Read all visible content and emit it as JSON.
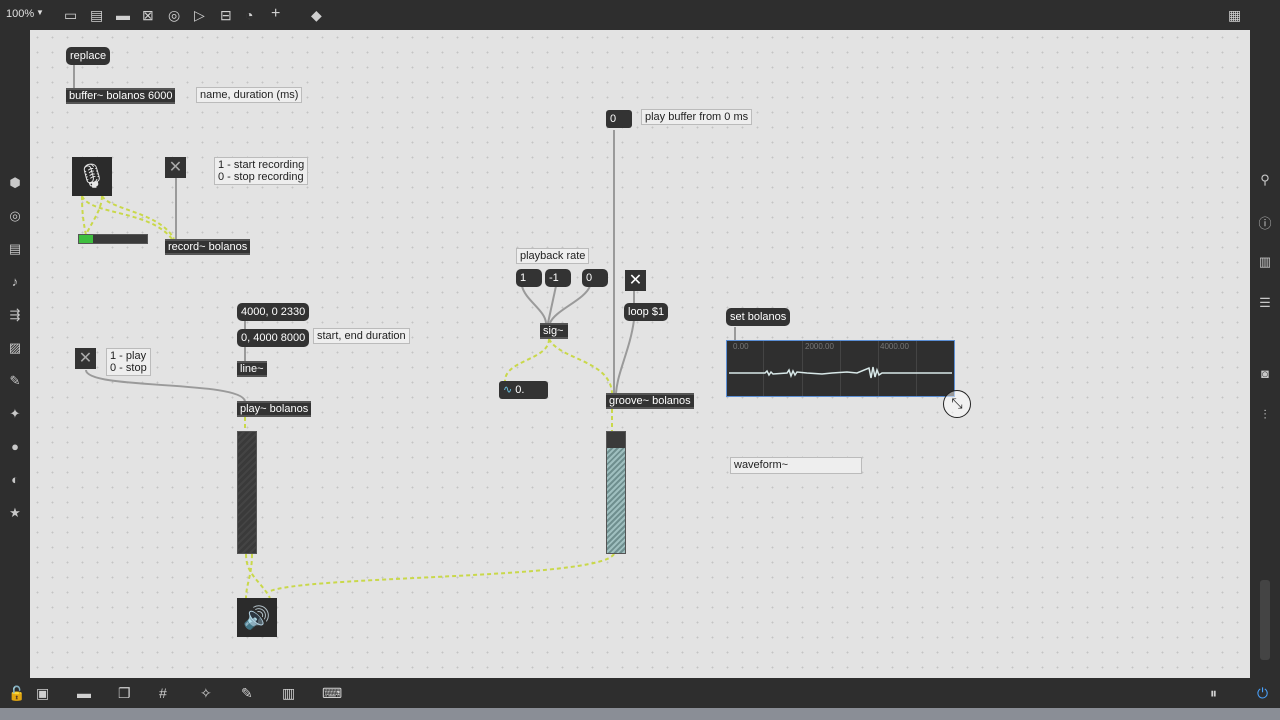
{
  "toolbar": {
    "zoom": "100%",
    "icons": [
      "new-object-icon",
      "message-icon",
      "comment-icon",
      "toggle-icon",
      "button-icon",
      "number-icon",
      "slider-icon",
      "dial-icon",
      "add-icon",
      "paint-icon",
      "grid-view-icon"
    ]
  },
  "left_sidebar": [
    "packages-icon",
    "target-icon",
    "browser-icon",
    "music-icon",
    "patcher-icon",
    "image-icon",
    "attachment-icon",
    "puzzle-icon",
    "vimeo-icon",
    "mask-icon",
    "star-icon"
  ],
  "right_sidebar": [
    "search-icon",
    "info-icon",
    "book-icon",
    "list-icon",
    "camera-icon",
    "sliders-icon"
  ],
  "bottom_toolbar": [
    "lock-icon",
    "presentation-icon",
    "comment-icon",
    "group-icon",
    "grid-icon",
    "snap-icon",
    "wrench-icon",
    "piano-icon",
    "keyboard-icon"
  ],
  "patch": {
    "replace_msg": "replace",
    "buffer_obj": "buffer~ bolanos 6000",
    "buffer_comment": "name, duration (ms)",
    "record_comment": "1 - start recording\n0 - stop recording",
    "record_obj": "record~ bolanos",
    "msg_4000_2330": "4000, 0 2330",
    "msg_0_4000_8000": "0, 4000 8000",
    "start_end_comment": "start, end duration",
    "line_obj": "line~",
    "play_comment": "1 - play\n0 - stop",
    "play_obj": "play~ bolanos",
    "playback_rate_comment": "playback rate",
    "msg_1": "1",
    "msg_neg1": "-1",
    "msg_0": "0",
    "sig_obj": "sig~",
    "sig_number": "0.",
    "number_zero": "0",
    "play_buffer_comment": "play buffer from 0 ms",
    "loop_msg": "loop $1",
    "groove_obj": "groove~ bolanos",
    "set_msg": "set bolanos",
    "waveform_obj": "waveform~",
    "waveform_ticks": [
      "0.00",
      "2000.00",
      "4000.00"
    ]
  },
  "colors": {
    "canvas": "#e3e3e3",
    "object": "#333333",
    "patch_cord_signal": "#c9d84a",
    "selection": "#5b8fd6",
    "meter_green": "#3fbf3f"
  }
}
